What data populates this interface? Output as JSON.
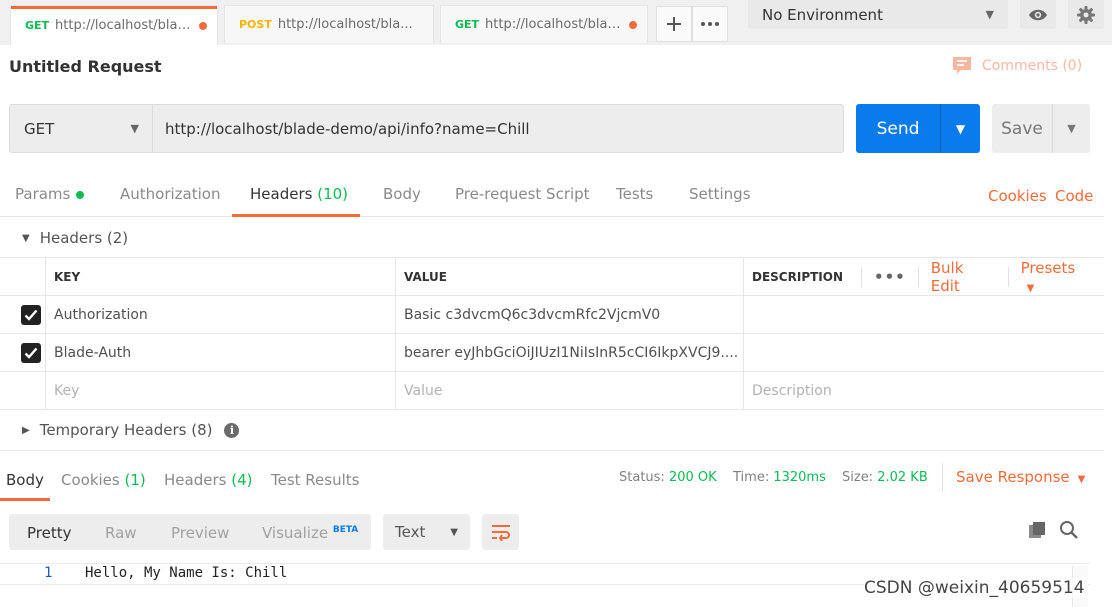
{
  "tabs": [
    {
      "method": "GET",
      "url": "http://localhost/blade...",
      "unsaved": true,
      "active": true
    },
    {
      "method": "POST",
      "url": "http://localhost/bla...",
      "unsaved": false,
      "active": false
    },
    {
      "method": "GET",
      "url": "http://localhost/blade...",
      "unsaved": true,
      "active": false
    }
  ],
  "tabbar": {
    "new_tab_icon": "plus-icon",
    "more_icon": "more-horizontal-icon"
  },
  "environment": {
    "selected": "No Environment",
    "eye_icon": "eye-icon",
    "settings_icon": "gear-icon"
  },
  "request": {
    "name": "Untitled Request",
    "comments_label": "Comments (0)",
    "method": "GET",
    "url": "http://localhost/blade-demo/api/info?name=Chill",
    "send_label": "Send",
    "save_label": "Save"
  },
  "request_tabs": {
    "params": "Params",
    "authorization": "Authorization",
    "headers": "Headers",
    "headers_count": "(10)",
    "body": "Body",
    "prerequest": "Pre-request Script",
    "tests": "Tests",
    "settings": "Settings",
    "cookies": "Cookies",
    "code": "Code"
  },
  "headers_section": {
    "title": "Headers (2)",
    "columns": {
      "key": "KEY",
      "value": "VALUE",
      "description": "DESCRIPTION"
    },
    "bulk_edit": "Bulk Edit",
    "presets": "Presets",
    "rows": [
      {
        "key": "Authorization",
        "value": "Basic c3dvcmQ6c3dvcmRfc2VjcmV0",
        "description": "",
        "checked": true
      },
      {
        "key": "Blade-Auth",
        "value": "bearer eyJhbGciOiJIUzI1NiIsInR5cCI6IkpXVCJ9....",
        "description": "",
        "checked": true
      }
    ],
    "placeholder": {
      "key": "Key",
      "value": "Value",
      "description": "Description"
    },
    "temporary": "Temporary Headers (8)"
  },
  "response": {
    "tabs": {
      "body": "Body",
      "cookies": "Cookies",
      "cookies_count": "(1)",
      "headers": "Headers",
      "headers_count": "(4)",
      "test_results": "Test Results"
    },
    "status_label": "Status:",
    "status_value": "200 OK",
    "time_label": "Time:",
    "time_value": "1320ms",
    "size_label": "Size:",
    "size_value": "2.02 KB",
    "save_response": "Save Response",
    "views": {
      "pretty": "Pretty",
      "raw": "Raw",
      "preview": "Preview",
      "visualize": "Visualize",
      "beta": "BETA"
    },
    "format": "Text",
    "line_number": "1",
    "body_text": "Hello, My Name Is: Chill"
  },
  "watermark": "CSDN @weixin_40659514",
  "colors": {
    "accent": "#f26b3a",
    "send_blue": "#097bed",
    "success_green": "#0cbb52",
    "post_yellow": "#ffb400"
  }
}
